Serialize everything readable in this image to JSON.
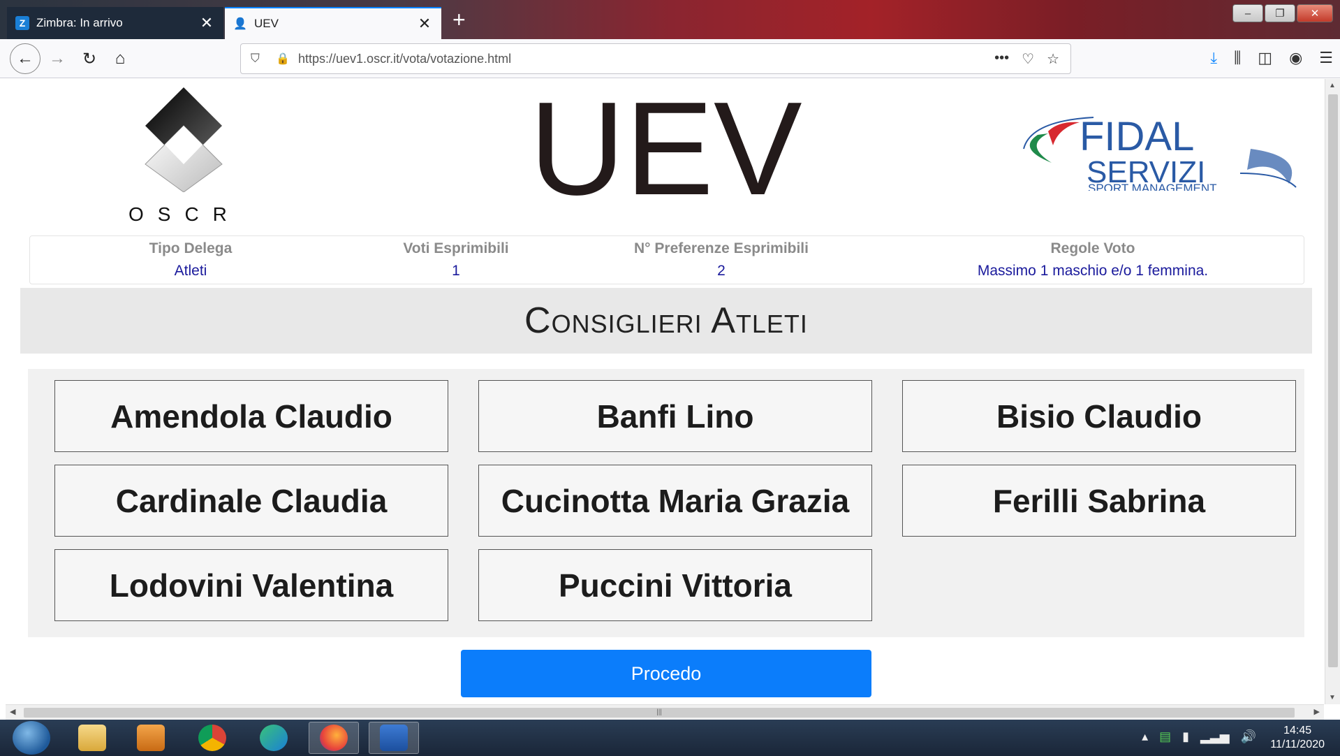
{
  "browser": {
    "tabs": [
      {
        "title": "Zimbra: In arrivo",
        "favicon": "Z"
      },
      {
        "title": "UEV"
      }
    ],
    "new_tab_label": "+",
    "url": "https://uev1.oscr.it/vota/votazione.html"
  },
  "header": {
    "logo_left_text": "OSCR",
    "title": "UEV",
    "logo_right_title": "FIDAL",
    "logo_right_subtitle": "SERVIZI",
    "logo_right_tagline": "SPORT MANAGEMENT"
  },
  "info": [
    {
      "label": "Tipo Delega",
      "value": "Atleti"
    },
    {
      "label": "Voti Esprimibili",
      "value": "1"
    },
    {
      "label": "N° Preferenze Esprimibili",
      "value": "2"
    },
    {
      "label": "Regole Voto",
      "value": "Massimo 1 maschio e/o 1 femmina."
    }
  ],
  "section_title": "Consiglieri Atleti",
  "candidates": [
    "Amendola Claudio",
    "Banfi Lino",
    "Bisio Claudio",
    "Cardinale Claudia",
    "Cucinotta Maria Grazia",
    "Ferilli Sabrina",
    "Lodovini Valentina",
    "Puccini Vittoria"
  ],
  "submit_label": "Procedo",
  "taskbar": {
    "time": "14:45",
    "date": "11/11/2020"
  },
  "colors": {
    "accent_button": "#0b7dfb",
    "info_value": "#1a1a9c",
    "fidal_green": "#1f8a4a",
    "fidal_red": "#d7282f",
    "fidal_blue": "#2a5aa5"
  }
}
